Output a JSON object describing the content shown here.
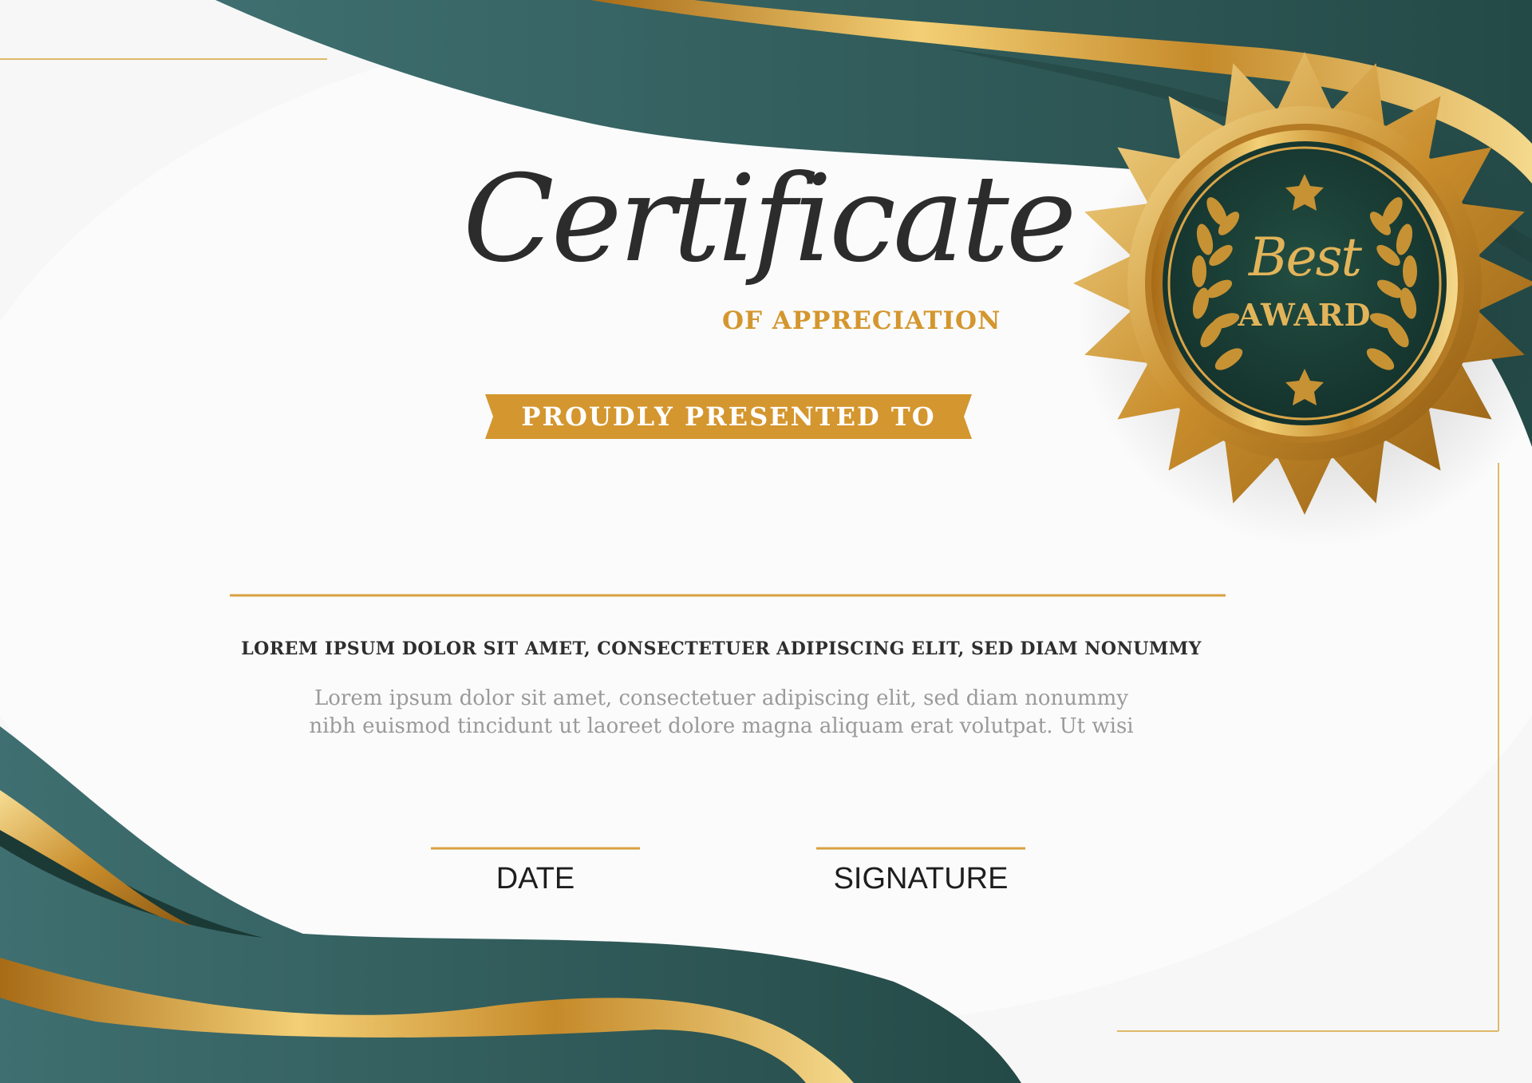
{
  "certificate": {
    "title": "Certificate",
    "subtitle": "OF APPRECIATION",
    "ribbon_text": "PROUDLY PRESENTED TO",
    "recipient_name": "",
    "body_heading": "LOREM IPSUM DOLOR SIT AMET, CONSECTETUER ADIPISCING ELIT, SED DIAM NONUMMY",
    "body_lines": [
      "Lorem ipsum dolor sit amet, consectetuer adipiscing elit, sed diam nonummy",
      "nibh euismod tincidunt ut laoreet dolore magna aliquam erat volutpat. Ut wisi"
    ],
    "date_label": "DATE",
    "signature_label": "SIGNATURE"
  },
  "badge": {
    "script_text": "Best",
    "text": "AWARD"
  },
  "colors": {
    "teal": "#2e5c5a",
    "dark_green": "#1e3a33",
    "gold": "#d4962e",
    "light_gold": "#f0c766",
    "text_dark": "#2c2c2c",
    "text_grey": "#9a9a9a"
  }
}
